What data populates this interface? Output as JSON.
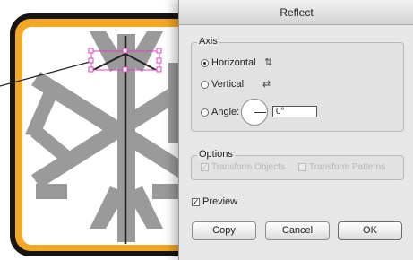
{
  "dialog": {
    "title": "Reflect",
    "axis": {
      "legend": "Axis",
      "horizontal_label": "Horizontal",
      "vertical_label": "Vertical",
      "angle_label": "Angle:",
      "angle_value": "0°",
      "selected": "horizontal"
    },
    "options": {
      "legend": "Options",
      "transform_objects_label": "Transform Objects",
      "transform_patterns_label": "Transform Patterns"
    },
    "preview_label": "Preview",
    "buttons": {
      "copy": "Copy",
      "cancel": "Cancel",
      "ok": "OK"
    }
  },
  "colors": {
    "frame_orange": "#f5a623",
    "frame_black": "#151515",
    "snowflake_gray": "#999999",
    "selection_magenta": "#e040c0"
  }
}
